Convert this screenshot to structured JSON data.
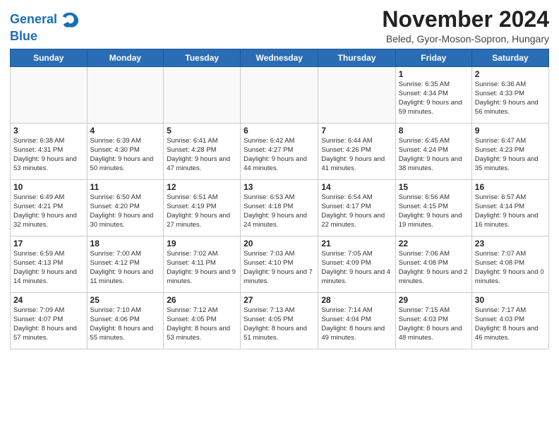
{
  "header": {
    "logo_line1": "General",
    "logo_line2": "Blue",
    "title": "November 2024",
    "subtitle": "Beled, Gyor-Moson-Sopron, Hungary"
  },
  "weekdays": [
    "Sunday",
    "Monday",
    "Tuesday",
    "Wednesday",
    "Thursday",
    "Friday",
    "Saturday"
  ],
  "weeks": [
    [
      {
        "day": null
      },
      {
        "day": null
      },
      {
        "day": null
      },
      {
        "day": null
      },
      {
        "day": null
      },
      {
        "day": "1",
        "sunrise": "Sunrise: 6:35 AM",
        "sunset": "Sunset: 4:34 PM",
        "daylight": "Daylight: 9 hours and 59 minutes."
      },
      {
        "day": "2",
        "sunrise": "Sunrise: 6:36 AM",
        "sunset": "Sunset: 4:33 PM",
        "daylight": "Daylight: 9 hours and 56 minutes."
      }
    ],
    [
      {
        "day": "3",
        "sunrise": "Sunrise: 6:38 AM",
        "sunset": "Sunset: 4:31 PM",
        "daylight": "Daylight: 9 hours and 53 minutes."
      },
      {
        "day": "4",
        "sunrise": "Sunrise: 6:39 AM",
        "sunset": "Sunset: 4:30 PM",
        "daylight": "Daylight: 9 hours and 50 minutes."
      },
      {
        "day": "5",
        "sunrise": "Sunrise: 6:41 AM",
        "sunset": "Sunset: 4:28 PM",
        "daylight": "Daylight: 9 hours and 47 minutes."
      },
      {
        "day": "6",
        "sunrise": "Sunrise: 6:42 AM",
        "sunset": "Sunset: 4:27 PM",
        "daylight": "Daylight: 9 hours and 44 minutes."
      },
      {
        "day": "7",
        "sunrise": "Sunrise: 6:44 AM",
        "sunset": "Sunset: 4:26 PM",
        "daylight": "Daylight: 9 hours and 41 minutes."
      },
      {
        "day": "8",
        "sunrise": "Sunrise: 6:45 AM",
        "sunset": "Sunset: 4:24 PM",
        "daylight": "Daylight: 9 hours and 38 minutes."
      },
      {
        "day": "9",
        "sunrise": "Sunrise: 6:47 AM",
        "sunset": "Sunset: 4:23 PM",
        "daylight": "Daylight: 9 hours and 35 minutes."
      }
    ],
    [
      {
        "day": "10",
        "sunrise": "Sunrise: 6:49 AM",
        "sunset": "Sunset: 4:21 PM",
        "daylight": "Daylight: 9 hours and 32 minutes."
      },
      {
        "day": "11",
        "sunrise": "Sunrise: 6:50 AM",
        "sunset": "Sunset: 4:20 PM",
        "daylight": "Daylight: 9 hours and 30 minutes."
      },
      {
        "day": "12",
        "sunrise": "Sunrise: 6:51 AM",
        "sunset": "Sunset: 4:19 PM",
        "daylight": "Daylight: 9 hours and 27 minutes."
      },
      {
        "day": "13",
        "sunrise": "Sunrise: 6:53 AM",
        "sunset": "Sunset: 4:18 PM",
        "daylight": "Daylight: 9 hours and 24 minutes."
      },
      {
        "day": "14",
        "sunrise": "Sunrise: 6:54 AM",
        "sunset": "Sunset: 4:17 PM",
        "daylight": "Daylight: 9 hours and 22 minutes."
      },
      {
        "day": "15",
        "sunrise": "Sunrise: 6:56 AM",
        "sunset": "Sunset: 4:15 PM",
        "daylight": "Daylight: 9 hours and 19 minutes."
      },
      {
        "day": "16",
        "sunrise": "Sunrise: 6:57 AM",
        "sunset": "Sunset: 4:14 PM",
        "daylight": "Daylight: 9 hours and 16 minutes."
      }
    ],
    [
      {
        "day": "17",
        "sunrise": "Sunrise: 6:59 AM",
        "sunset": "Sunset: 4:13 PM",
        "daylight": "Daylight: 9 hours and 14 minutes."
      },
      {
        "day": "18",
        "sunrise": "Sunrise: 7:00 AM",
        "sunset": "Sunset: 4:12 PM",
        "daylight": "Daylight: 9 hours and 11 minutes."
      },
      {
        "day": "19",
        "sunrise": "Sunrise: 7:02 AM",
        "sunset": "Sunset: 4:11 PM",
        "daylight": "Daylight: 9 hours and 9 minutes."
      },
      {
        "day": "20",
        "sunrise": "Sunrise: 7:03 AM",
        "sunset": "Sunset: 4:10 PM",
        "daylight": "Daylight: 9 hours and 7 minutes."
      },
      {
        "day": "21",
        "sunrise": "Sunrise: 7:05 AM",
        "sunset": "Sunset: 4:09 PM",
        "daylight": "Daylight: 9 hours and 4 minutes."
      },
      {
        "day": "22",
        "sunrise": "Sunrise: 7:06 AM",
        "sunset": "Sunset: 4:08 PM",
        "daylight": "Daylight: 9 hours and 2 minutes."
      },
      {
        "day": "23",
        "sunrise": "Sunrise: 7:07 AM",
        "sunset": "Sunset: 4:08 PM",
        "daylight": "Daylight: 9 hours and 0 minutes."
      }
    ],
    [
      {
        "day": "24",
        "sunrise": "Sunrise: 7:09 AM",
        "sunset": "Sunset: 4:07 PM",
        "daylight": "Daylight: 8 hours and 57 minutes."
      },
      {
        "day": "25",
        "sunrise": "Sunrise: 7:10 AM",
        "sunset": "Sunset: 4:06 PM",
        "daylight": "Daylight: 8 hours and 55 minutes."
      },
      {
        "day": "26",
        "sunrise": "Sunrise: 7:12 AM",
        "sunset": "Sunset: 4:05 PM",
        "daylight": "Daylight: 8 hours and 53 minutes."
      },
      {
        "day": "27",
        "sunrise": "Sunrise: 7:13 AM",
        "sunset": "Sunset: 4:05 PM",
        "daylight": "Daylight: 8 hours and 51 minutes."
      },
      {
        "day": "28",
        "sunrise": "Sunrise: 7:14 AM",
        "sunset": "Sunset: 4:04 PM",
        "daylight": "Daylight: 8 hours and 49 minutes."
      },
      {
        "day": "29",
        "sunrise": "Sunrise: 7:15 AM",
        "sunset": "Sunset: 4:03 PM",
        "daylight": "Daylight: 8 hours and 48 minutes."
      },
      {
        "day": "30",
        "sunrise": "Sunrise: 7:17 AM",
        "sunset": "Sunset: 4:03 PM",
        "daylight": "Daylight: 8 hours and 46 minutes."
      }
    ]
  ]
}
